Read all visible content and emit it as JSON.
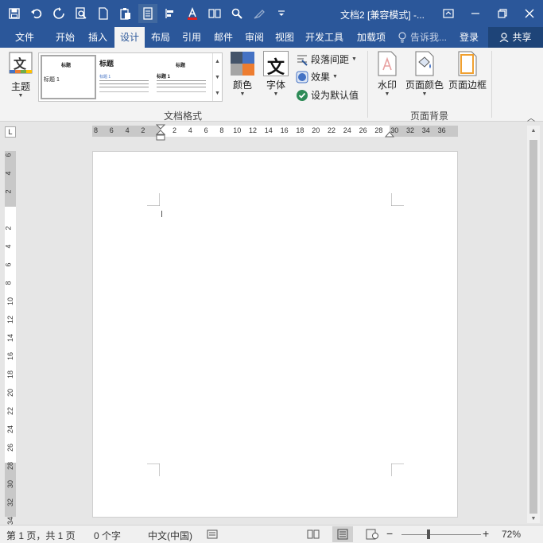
{
  "title_bar": {
    "title": "文档2 [兼容模式] -...",
    "qat": [
      "save-icon",
      "undo-icon",
      "redo-icon",
      "print-preview-icon",
      "new-doc-icon",
      "paste-icon",
      "document-icon",
      "align-icon",
      "font-color-icon",
      "columns-icon",
      "find-icon",
      "format-painter-icon",
      "customize-icon"
    ],
    "controls": [
      "ribbon-display-icon",
      "minimize-icon",
      "restore-icon",
      "close-icon"
    ]
  },
  "tabs": {
    "file": "文件",
    "home": "开始",
    "insert": "插入",
    "design": "设计",
    "layout": "布局",
    "references": "引用",
    "mailings": "邮件",
    "review": "审阅",
    "view": "视图",
    "developer": "开发工具",
    "addins": "加载项",
    "tell_me": "告诉我...",
    "login": "登录",
    "share": "共享"
  },
  "ribbon": {
    "themes": "主题",
    "themes_icon_char": "文",
    "gallery": {
      "thumb1_title": "标题",
      "thumb1_heading": "标题 1",
      "thumb2_title": "标题",
      "thumb2_heading": "标题 1",
      "thumb3_title": "标题",
      "thumb3_heading": "标题 1"
    },
    "colors": "颜色",
    "fonts": "字体",
    "fonts_icon_char": "文",
    "paragraph_spacing": "段落间距",
    "effects": "效果",
    "set_default": "设为默认值",
    "group_document_format": "文档格式",
    "watermark": "水印",
    "page_color": "页面颜色",
    "page_borders": "页面边框",
    "group_page_background": "页面背景",
    "colors_swatch": [
      "#44546a",
      "#4472c4",
      "#ed7d31",
      "#a5a5a5"
    ]
  },
  "ruler": {
    "h_numbers": [
      "8",
      "6",
      "4",
      "2",
      "",
      "2",
      "4",
      "6",
      "8",
      "10",
      "12",
      "14",
      "16",
      "18",
      "20",
      "22",
      "24",
      "26",
      "28",
      "30",
      "32",
      "34",
      "36"
    ],
    "v_numbers": [
      "6",
      "4",
      "2",
      "",
      "2",
      "4",
      "6",
      "8",
      "10",
      "12",
      "14",
      "16",
      "18",
      "20",
      "22",
      "24",
      "26",
      "28",
      "30",
      "32",
      "34"
    ],
    "tab_selector": "L"
  },
  "status_bar": {
    "page": "第 1 页，共 1 页",
    "words": "0 个字",
    "language": "中文(中国)",
    "zoom": "72%",
    "zoom_out": "−",
    "zoom_in": "+"
  },
  "colors": {
    "accent": "#2b579a",
    "ribbon_bg": "#f3f3f3",
    "canvas_bg": "#e6e6e6"
  }
}
